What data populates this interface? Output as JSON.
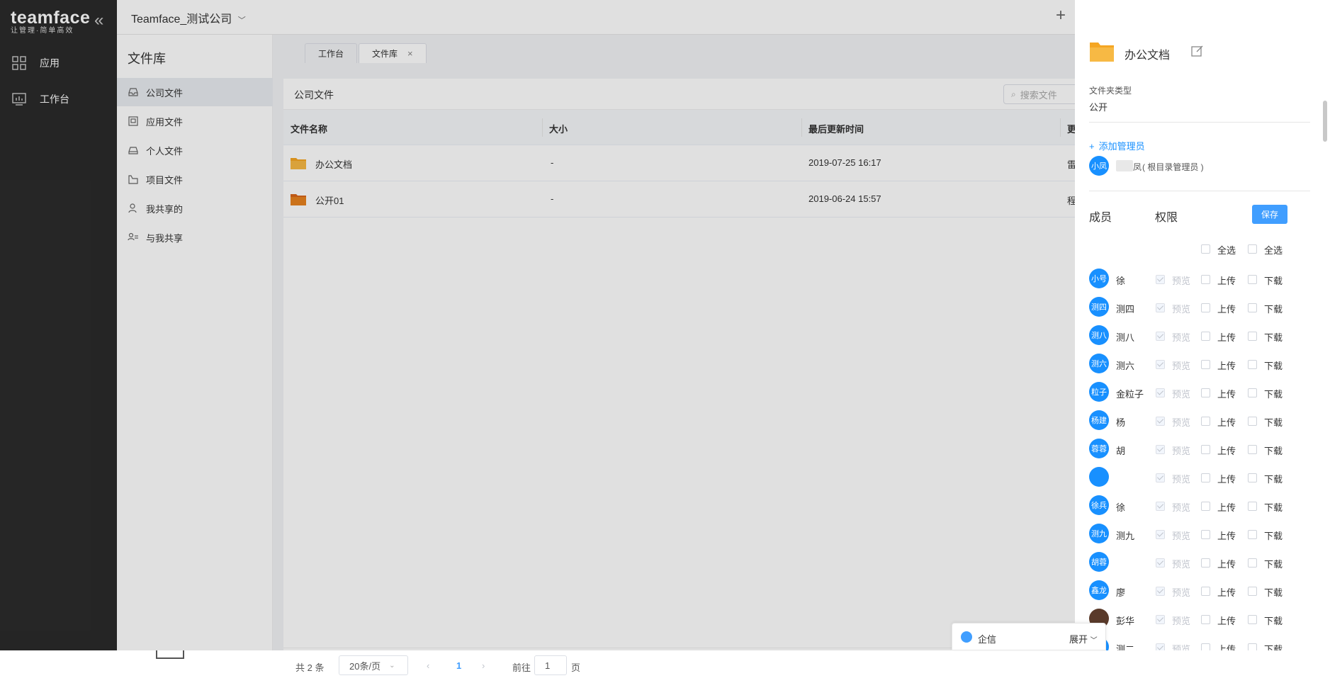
{
  "app": {
    "brand": "teamface",
    "slogan": "让管理·简单高效",
    "company": "Teamface_测试公司"
  },
  "nav": [
    {
      "label": "应用",
      "icon": "apps-grid-icon"
    },
    {
      "label": "工作台",
      "icon": "dashboard-chart-icon"
    }
  ],
  "sidebar": {
    "title": "文件库",
    "items": [
      {
        "label": "公司文件",
        "icon": "inbox-icon",
        "active": true
      },
      {
        "label": "应用文件",
        "icon": "app-file-icon"
      },
      {
        "label": "个人文件",
        "icon": "drive-icon"
      },
      {
        "label": "项目文件",
        "icon": "project-folder-icon"
      },
      {
        "label": "我共享的",
        "icon": "user-share-icon"
      },
      {
        "label": "与我共享",
        "icon": "shared-with-me-icon"
      }
    ]
  },
  "tabs": [
    {
      "label": "工作台"
    },
    {
      "label": "文件库",
      "active": true,
      "close": "×"
    }
  ],
  "files": {
    "heading": "公司文件",
    "search_placeholder": "搜索文件",
    "columns": [
      "文件名称",
      "大小",
      "最后更新时间",
      "更"
    ],
    "rows": [
      {
        "name": "办公文档",
        "size": "-",
        "updated": "2019-07-25 16:17",
        "extra": "雷",
        "folder_color": "#f5a623"
      },
      {
        "name": "公开01",
        "size": "-",
        "updated": "2019-06-24 15:57",
        "extra": "程",
        "folder_color": "#e8821e"
      }
    ],
    "pager": {
      "total": "共 2 条",
      "page_size": "20条/页",
      "current": "1",
      "goto_prefix": "前往",
      "goto_value": "1",
      "goto_suffix": "页"
    }
  },
  "panel": {
    "folder_name": "办公文档",
    "type_label": "文件夹类型",
    "type_value": "公开",
    "add_admin": "添加管理员",
    "admin": {
      "avatar": "小凤",
      "name_tail": "凤",
      "note": "( 根目录管理员 )"
    },
    "members_label": "成员",
    "perm_label": "权限",
    "save": "保存",
    "select_all": [
      "全选",
      "全选"
    ],
    "perm_names": {
      "preview": "预览",
      "upload": "上传",
      "download": "下载"
    },
    "members": [
      {
        "avatar": "小号",
        "name": "徐"
      },
      {
        "avatar": "测四",
        "name": "测四"
      },
      {
        "avatar": "测八",
        "name": "测八"
      },
      {
        "avatar": "测六",
        "name": "测六"
      },
      {
        "avatar": "粒子",
        "name": "金粒子"
      },
      {
        "avatar": "杨建",
        "name": "杨"
      },
      {
        "avatar": "蓉蓉",
        "name": "胡"
      },
      {
        "avatar": "",
        "name": ""
      },
      {
        "avatar": "徐兵",
        "name": "徐"
      },
      {
        "avatar": "测九",
        "name": "测九"
      },
      {
        "avatar": "胡蓉",
        "name": ""
      },
      {
        "avatar": "鑫龙",
        "name": "廖"
      },
      {
        "avatar": "",
        "name": "彭华",
        "photo": true
      },
      {
        "avatar": "",
        "name": "测二"
      }
    ]
  },
  "chat": {
    "label": "企信",
    "expand": "展开"
  },
  "colors": {
    "accent": "#1890ff",
    "nav_bg": "#2b2b2b",
    "save_btn": "#409eff"
  }
}
